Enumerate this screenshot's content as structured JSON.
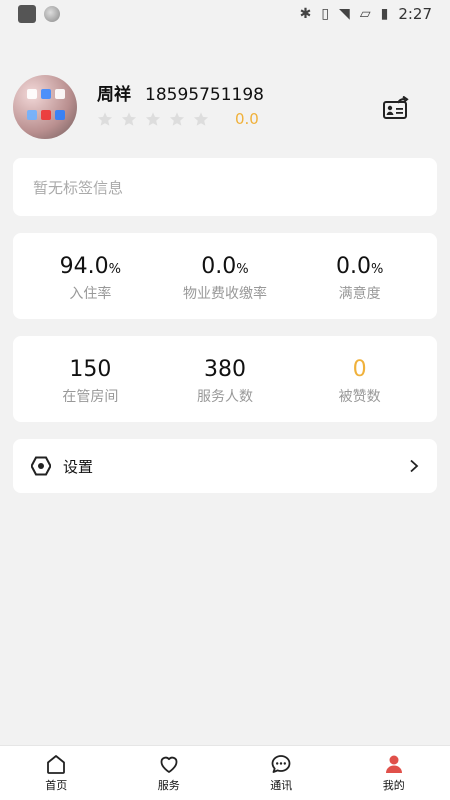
{
  "status_bar": {
    "time": "2:27",
    "icons": [
      "bluetooth-icon",
      "vibrate-icon",
      "wifi-icon",
      "no-sim-icon",
      "battery-icon"
    ]
  },
  "profile": {
    "name": "周祥",
    "phone": "18595751198",
    "rating": "0.0",
    "stars_filled": 0,
    "stars_total": 5
  },
  "tags": {
    "placeholder": "暂无标签信息"
  },
  "stats_row1": [
    {
      "value": "94.0",
      "unit": "%",
      "label": "入住率"
    },
    {
      "value": "0.0",
      "unit": "%",
      "label": "物业费收缴率"
    },
    {
      "value": "0.0",
      "unit": "%",
      "label": "满意度"
    }
  ],
  "stats_row2": [
    {
      "value": "150",
      "label": "在管房间"
    },
    {
      "value": "380",
      "label": "服务人数"
    },
    {
      "value": "0",
      "label": "被赞数"
    }
  ],
  "settings": {
    "label": "设置"
  },
  "tabbar": {
    "items": [
      {
        "label": "首页",
        "icon": "home-icon"
      },
      {
        "label": "服务",
        "icon": "heart-icon"
      },
      {
        "label": "通讯",
        "icon": "chat-icon"
      },
      {
        "label": "我的",
        "icon": "person-icon"
      }
    ],
    "active": "我的"
  },
  "colors": {
    "accent": "#f0b13b",
    "active_tab": "#e0504a"
  }
}
